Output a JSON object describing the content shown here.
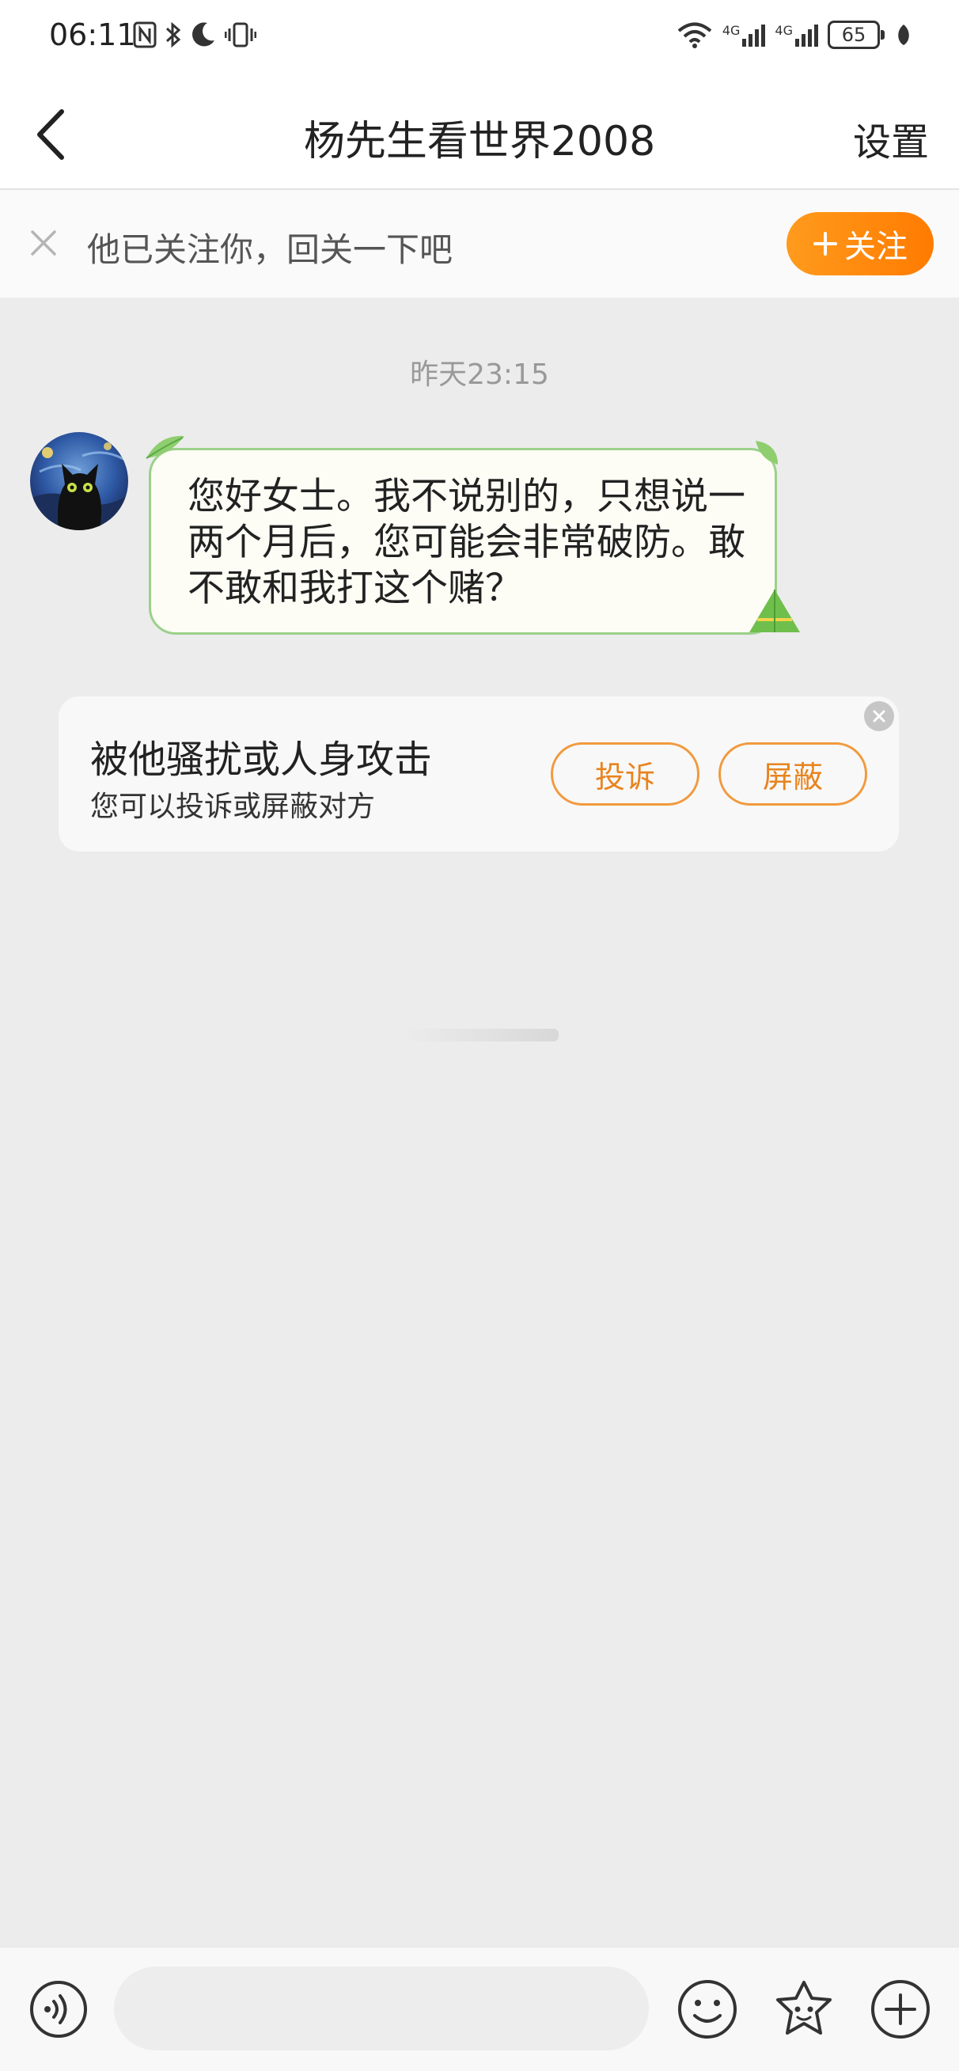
{
  "status_bar": {
    "time": "06:11",
    "battery": "65",
    "network_1": "4G",
    "network_2": "4G"
  },
  "nav": {
    "title": "杨先生看世界2008",
    "settings_label": "设置"
  },
  "follow_banner": {
    "text": "他已关注你，回关一下吧",
    "follow_button": "关注"
  },
  "chat": {
    "timestamp": "昨天23:15",
    "messages": [
      {
        "text": "您好女士。我不说别的，只想说一两个月后，您可能会非常破防。敢不敢和我打这个赌？"
      }
    ]
  },
  "safety_card": {
    "title": "被他骚扰或人身攻击",
    "subtitle": "您可以投诉或屏蔽对方",
    "report_button": "投诉",
    "block_button": "屏蔽"
  },
  "colors": {
    "accent_orange": "#ff8a0c",
    "bubble_border": "#9bd08a",
    "background": "#ececec"
  },
  "icons": {
    "back": "chevron-left-icon",
    "close": "close-icon",
    "voice": "voice-icon",
    "emoji": "emoji-icon",
    "sticker": "sticker-icon",
    "more": "plus-icon"
  }
}
